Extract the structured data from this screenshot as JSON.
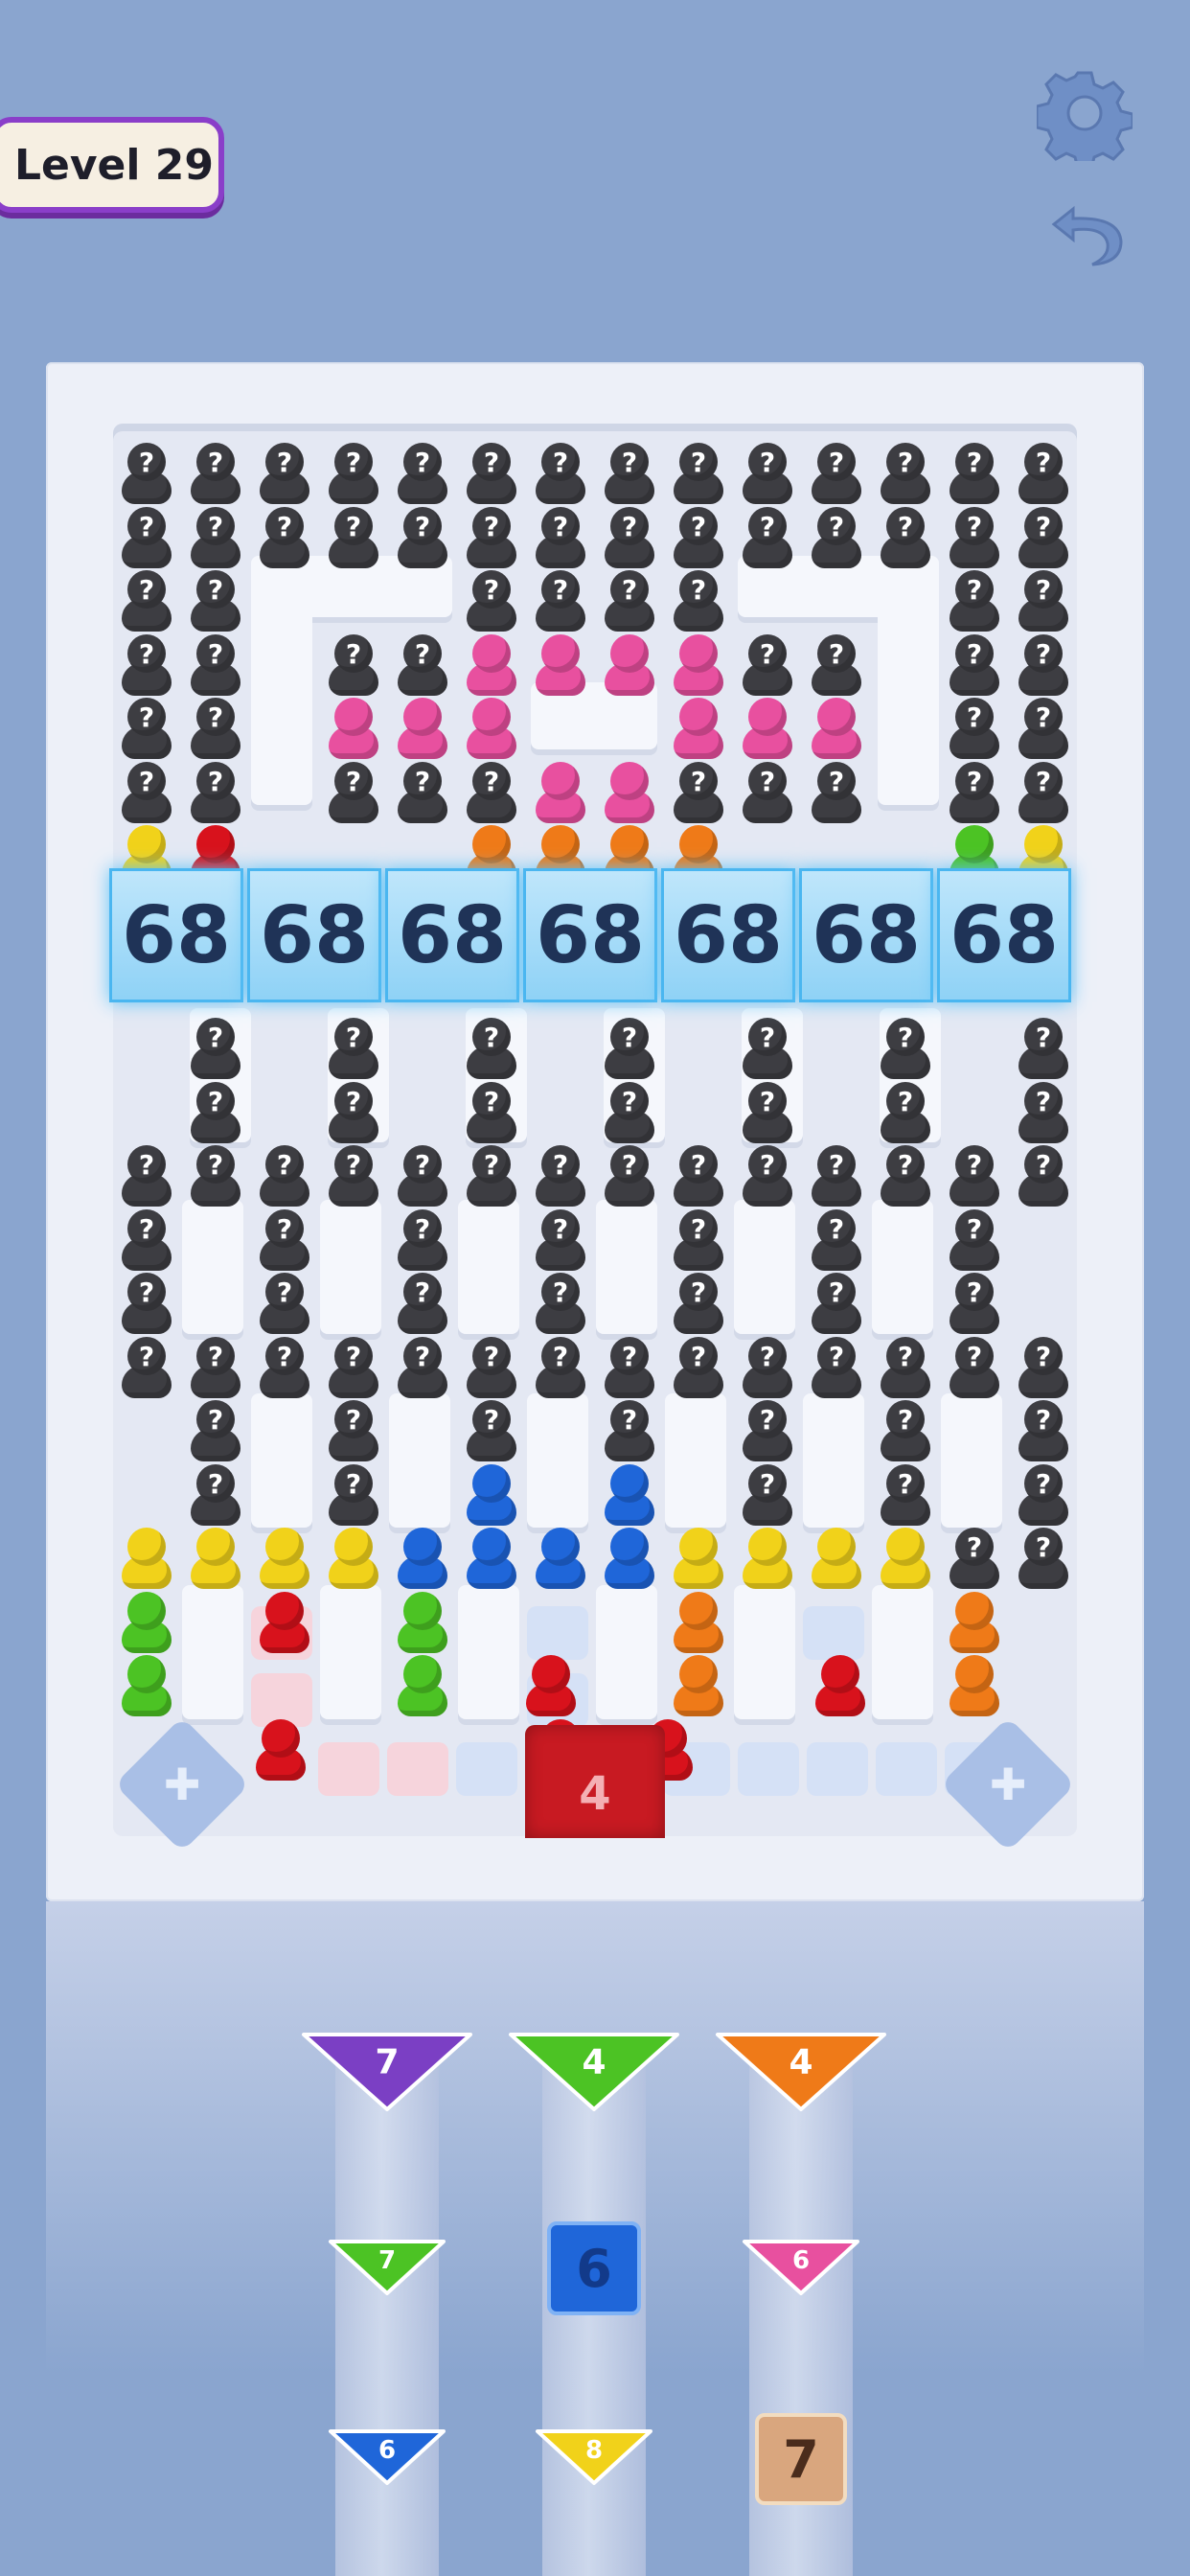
{
  "level": {
    "label": "Level 29"
  },
  "hud": {
    "settings_icon": "gear-icon",
    "undo_icon": "undo-icon"
  },
  "colors": {
    "gray": "#3d3d42",
    "pink": "#e8509f",
    "yellow": "#f1d21a",
    "red": "#d8121c",
    "orange": "#ef7a18",
    "green": "#4cc324",
    "blue": "#1f66d9",
    "purple": "#7b3fc4"
  },
  "barrier": {
    "counters": [
      "68",
      "68",
      "68",
      "68",
      "68",
      "68",
      "68"
    ]
  },
  "exit": {
    "count": "4"
  },
  "queues": [
    {
      "name": "left",
      "items": [
        {
          "kind": "triangle",
          "color": "purple",
          "value": "7"
        },
        {
          "kind": "triangle",
          "color": "green",
          "value": "7"
        },
        {
          "kind": "triangle",
          "color": "blue",
          "value": "6"
        }
      ]
    },
    {
      "name": "middle",
      "items": [
        {
          "kind": "triangle",
          "color": "green",
          "value": "4"
        },
        {
          "kind": "box",
          "color": "blue",
          "value": "6"
        },
        {
          "kind": "triangle",
          "color": "yellow",
          "value": "8"
        }
      ]
    },
    {
      "name": "right",
      "items": [
        {
          "kind": "triangle",
          "color": "orange",
          "value": "4"
        },
        {
          "kind": "triangle",
          "color": "pink",
          "value": "6"
        },
        {
          "kind": "box",
          "color": "tan",
          "value": "7"
        }
      ]
    }
  ]
}
